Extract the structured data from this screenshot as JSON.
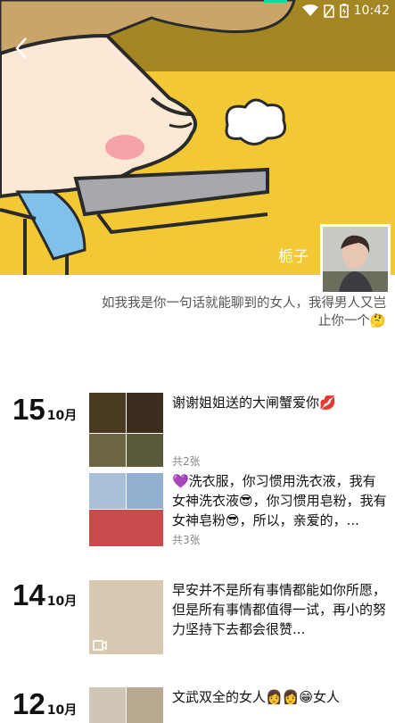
{
  "status_bar": {
    "time": "10:42"
  },
  "profile": {
    "nickname": "栀子",
    "signature": "如我我是你一句话就能聊到的女人，我得男人又岂止你一个🤔"
  },
  "feed": [
    {
      "day": "15",
      "month": "10月",
      "posts": [
        {
          "text": "谢谢姐姐送的大闸蟹爱你💋",
          "count": "共2张"
        },
        {
          "text": "💜洗衣服，你习惯用洗衣液，我有女神洗衣液😎，你习惯用皂粉，我有女神皂粉😎，所以，亲爱的，...",
          "count": "共3张"
        }
      ]
    },
    {
      "day": "14",
      "month": "10月",
      "posts": [
        {
          "text": "早安并不是所有事情都能如你所愿，但是所有事情都值得一试，再小的努力坚持下去都会很赞..."
        }
      ]
    },
    {
      "day": "12",
      "month": "10月",
      "posts": [
        {
          "text": "文武双全的女人👩👩😁女人"
        }
      ]
    }
  ]
}
